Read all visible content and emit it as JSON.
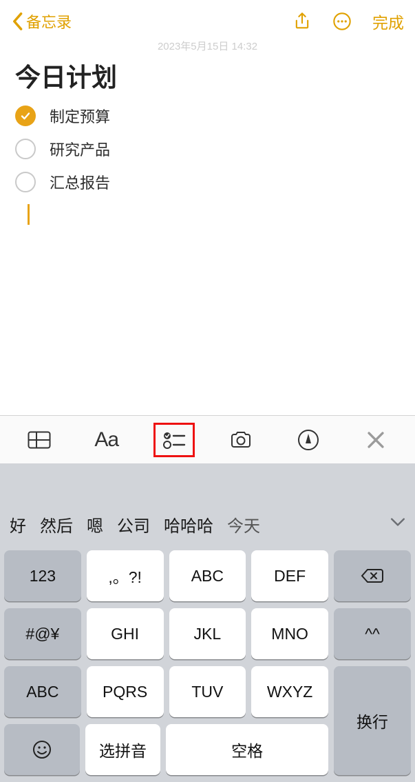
{
  "nav": {
    "back_label": "备忘录",
    "done_label": "完成"
  },
  "timestamp": "2023年5月15日 14:32",
  "note": {
    "title": "今日计划",
    "items": [
      {
        "label": "制定预算",
        "checked": true
      },
      {
        "label": "研究产品",
        "checked": false
      },
      {
        "label": "汇总报告",
        "checked": false
      }
    ]
  },
  "toolbar": {
    "aa_label": "Aa"
  },
  "keyboard": {
    "suggestions": [
      "好",
      "然后",
      "嗯",
      "公司",
      "哈哈哈",
      "今天"
    ],
    "keys": {
      "num": "123",
      "punct": ",。?!",
      "abc": "ABC",
      "def": "DEF",
      "sym": "#@¥",
      "ghi": "GHI",
      "jkl": "JKL",
      "mno": "MNO",
      "caps": "ABC",
      "pqrs": "PQRS",
      "tuv": "TUV",
      "wxyz": "WXYZ",
      "pinyin": "选拼音",
      "space": "空格",
      "face": "^^",
      "enter": "换行"
    }
  }
}
